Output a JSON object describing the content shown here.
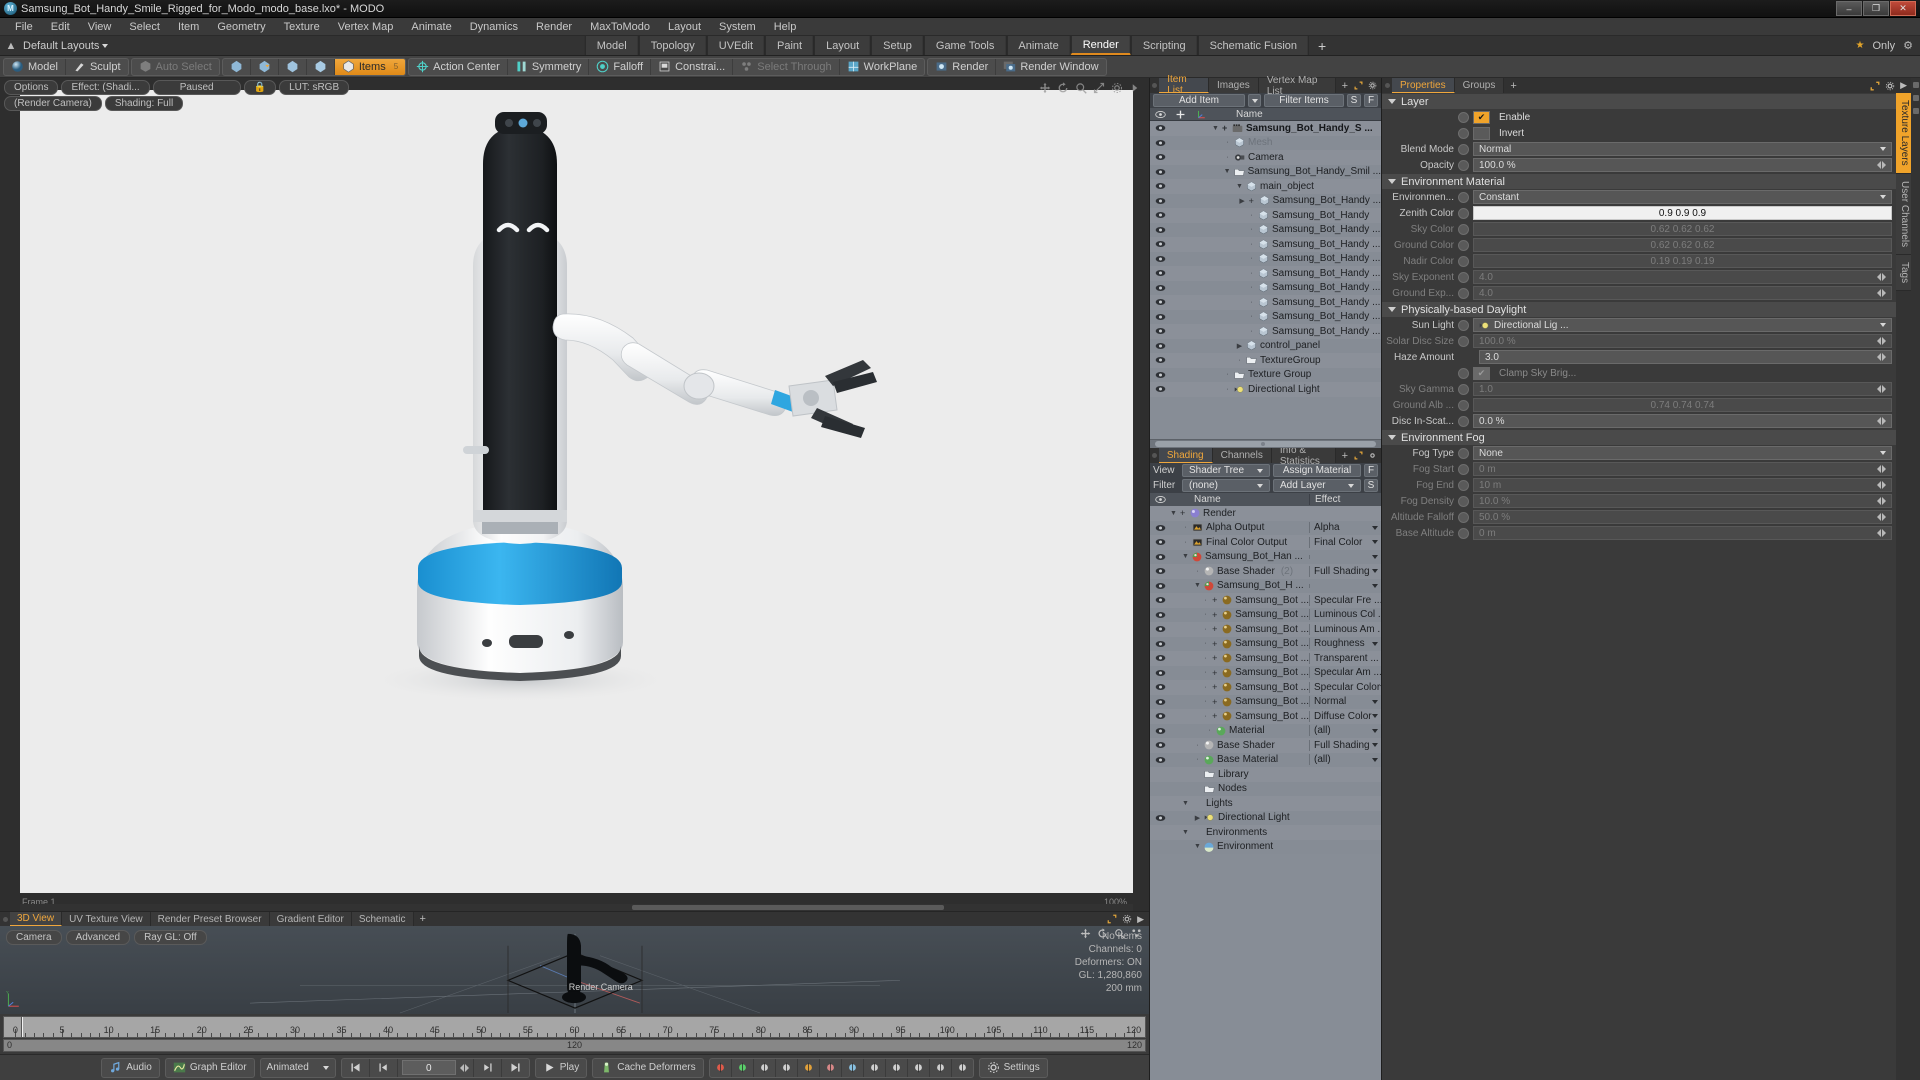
{
  "window": {
    "title": "Samsung_Bot_Handy_Smile_Rigged_for_Modo_modo_base.lxo* - MODO",
    "app_icon": "modo-logo-icon",
    "minimize": "–",
    "maximize": "❐",
    "close": "✕"
  },
  "menubar": {
    "items": [
      "File",
      "Edit",
      "View",
      "Select",
      "Item",
      "Geometry",
      "Texture",
      "Vertex Map",
      "Animate",
      "Dynamics",
      "Render",
      "MaxToModo",
      "Layout",
      "System",
      "Help"
    ]
  },
  "layoutbar": {
    "dropdown_label": "Default Layouts",
    "tabs": [
      {
        "label": "Model",
        "active": false
      },
      {
        "label": "Topology",
        "active": false
      },
      {
        "label": "UVEdit",
        "active": false
      },
      {
        "label": "Paint",
        "active": false
      },
      {
        "label": "Layout",
        "active": false
      },
      {
        "label": "Setup",
        "active": false
      },
      {
        "label": "Game Tools",
        "active": false
      },
      {
        "label": "Animate",
        "active": false
      },
      {
        "label": "Render",
        "active": true
      },
      {
        "label": "Scripting",
        "active": false
      },
      {
        "label": "Schematic Fusion",
        "active": false
      }
    ],
    "add_tab": "+",
    "only_label": "Only",
    "star_icon": "star-icon",
    "gear_icon": "gear-icon"
  },
  "toolbar": {
    "group1": [
      {
        "label": "Model",
        "icon": "sphere-icon",
        "state": "normal"
      },
      {
        "label": "Sculpt",
        "icon": "brush-icon",
        "state": "normal"
      }
    ],
    "group2": [
      {
        "label": "Auto Select",
        "icon": "cube-gray-icon",
        "state": "dim"
      }
    ],
    "group3": [
      {
        "label": "",
        "icon": "vertex-icon",
        "state": "normal"
      },
      {
        "label": "",
        "icon": "edge-icon",
        "state": "normal"
      },
      {
        "label": "",
        "icon": "polygon-icon",
        "state": "normal"
      },
      {
        "label": "",
        "icon": "material-icon",
        "state": "normal"
      },
      {
        "label": "Items",
        "icon": "cube-icon",
        "state": "active",
        "badge": "5"
      }
    ],
    "group4": [
      {
        "label": "Action Center",
        "icon": "target-icon",
        "state": "normal"
      },
      {
        "label": "Symmetry",
        "icon": "symmetry-icon",
        "state": "normal"
      },
      {
        "label": "Falloff",
        "icon": "falloff-icon",
        "state": "normal"
      },
      {
        "label": "Constrai...",
        "icon": "constraint-icon",
        "state": "normal"
      },
      {
        "label": "Select Through",
        "icon": "select-through-icon",
        "state": "dim"
      },
      {
        "label": "WorkPlane",
        "icon": "workplane-icon",
        "state": "normal"
      }
    ],
    "group5": [
      {
        "label": "Render",
        "icon": "render-icon",
        "state": "normal"
      },
      {
        "label": "Render Window",
        "icon": "render-window-icon",
        "state": "normal"
      }
    ]
  },
  "viewport": {
    "pills_row1": [
      "Options",
      "Effect: (Shadi...",
      "Paused"
    ],
    "lock_icon": "lock-icon",
    "lut_label": "LUT: sRGB",
    "pills_row2": [
      "(Render Camera)",
      "Shading: Full"
    ],
    "icons": [
      "move-icon",
      "rotate-icon",
      "zoom-icon",
      "fit-icon",
      "gear-icon",
      "expand-icon"
    ],
    "corner_left": "Frame 1",
    "corner_right": "100%",
    "subject": "Samsung Bot Handy service robot render"
  },
  "item_list": {
    "tabs": [
      {
        "label": "Item List",
        "active": true
      },
      {
        "label": "Images",
        "active": false
      },
      {
        "label": "Vertex Map List",
        "active": false
      }
    ],
    "add_tab": "+",
    "expand_icon": "expand-icon",
    "gear_icon": "gear-icon",
    "add_item_label": "Add Item",
    "filter_items_label": "Filter Items",
    "s_button": "S",
    "f_button": "F",
    "columns": {
      "eye": "visibility-icon",
      "lock": "lock-column-icon",
      "axis": "transform-icon",
      "name": "Name"
    },
    "rows": [
      {
        "label": "Samsung_Bot_Handy_S ...",
        "icon": "scene-icon",
        "indent": 1,
        "eye": true,
        "disclosure": "down",
        "plus": true,
        "bold": true
      },
      {
        "label": "Mesh",
        "icon": "cube-icon",
        "indent": 2,
        "eye": true,
        "disclosure": "dot",
        "dim": true
      },
      {
        "label": "Camera",
        "icon": "camera-icon",
        "indent": 2,
        "eye": true,
        "disclosure": "dot"
      },
      {
        "label": "Samsung_Bot_Handy_Smil ...",
        "icon": "folder-icon",
        "indent": 2,
        "eye": true,
        "disclosure": "down"
      },
      {
        "label": "main_object",
        "icon": "cube-icon",
        "indent": 3,
        "eye": true,
        "disclosure": "down"
      },
      {
        "label": "Samsung_Bot_Handy ...",
        "icon": "cube-icon",
        "indent": 4,
        "eye": true,
        "disclosure": "right",
        "plus": true
      },
      {
        "label": "Samsung_Bot_Handy",
        "icon": "cube-icon",
        "indent": 4,
        "eye": true,
        "disclosure": "dot"
      },
      {
        "label": "Samsung_Bot_Handy ...",
        "icon": "cube-icon",
        "indent": 4,
        "eye": true,
        "disclosure": "dot"
      },
      {
        "label": "Samsung_Bot_Handy ...",
        "icon": "cube-icon",
        "indent": 4,
        "eye": true,
        "disclosure": "dot"
      },
      {
        "label": "Samsung_Bot_Handy ...",
        "icon": "cube-icon",
        "indent": 4,
        "eye": true,
        "disclosure": "dot"
      },
      {
        "label": "Samsung_Bot_Handy ...",
        "icon": "cube-icon",
        "indent": 4,
        "eye": true,
        "disclosure": "dot"
      },
      {
        "label": "Samsung_Bot_Handy ...",
        "icon": "cube-icon",
        "indent": 4,
        "eye": true,
        "disclosure": "dot"
      },
      {
        "label": "Samsung_Bot_Handy ...",
        "icon": "cube-icon",
        "indent": 4,
        "eye": true,
        "disclosure": "dot"
      },
      {
        "label": "Samsung_Bot_Handy ...",
        "icon": "cube-icon",
        "indent": 4,
        "eye": true,
        "disclosure": "dot"
      },
      {
        "label": "Samsung_Bot_Handy ...",
        "icon": "cube-icon",
        "indent": 4,
        "eye": true,
        "disclosure": "dot"
      },
      {
        "label": "control_panel",
        "icon": "cube-icon",
        "indent": 3,
        "eye": true,
        "disclosure": "right"
      },
      {
        "label": "TextureGroup",
        "icon": "folder-icon",
        "indent": 3,
        "eye": true,
        "disclosure": "dot"
      },
      {
        "label": "Texture Group",
        "icon": "folder-icon",
        "indent": 2,
        "eye": true,
        "disclosure": "dot"
      },
      {
        "label": "Directional Light",
        "icon": "light-icon",
        "indent": 2,
        "eye": true,
        "disclosure": "dot"
      }
    ]
  },
  "shading": {
    "tabs": [
      {
        "label": "Shading",
        "active": true
      },
      {
        "label": "Channels",
        "active": false
      },
      {
        "label": "Info & Statistics",
        "active": false
      }
    ],
    "add_tab": "+",
    "view_label": "View",
    "view_value": "Shader Tree",
    "assign_material": "Assign Material",
    "filter_label": "Filter",
    "filter_value": "(none)",
    "add_layer": "Add Layer",
    "f_button": "F",
    "s_button": "S",
    "columns": {
      "eye": "visibility-icon",
      "name": "Name",
      "effect": "Effect"
    },
    "rows": [
      {
        "label": "Render",
        "effect": "",
        "icon": "render-sphere-icon",
        "indent": 1,
        "eye": false,
        "disclosure": "down",
        "plus": true
      },
      {
        "label": "Alpha Output",
        "effect": "Alpha",
        "icon": "image-icon",
        "indent": 2,
        "eye": true,
        "disclosure": "dot",
        "caret": true
      },
      {
        "label": "Final Color Output",
        "effect": "Final Color",
        "icon": "image-icon",
        "indent": 2,
        "eye": true,
        "disclosure": "dot",
        "caret": true
      },
      {
        "label": "Samsung_Bot_Han ...",
        "effect": "",
        "icon": "material-red-icon",
        "indent": 2,
        "eye": true,
        "disclosure": "down",
        "caret": true
      },
      {
        "label": "Base Shader",
        "effect": "Full Shading",
        "sub": "(2)",
        "icon": "shader-icon",
        "indent": 3,
        "eye": true,
        "disclosure": "dot",
        "caret": true
      },
      {
        "label": "Samsung_Bot_H ...",
        "effect": "",
        "icon": "material-red-icon",
        "indent": 3,
        "eye": true,
        "disclosure": "down",
        "caret": true
      },
      {
        "label": "Samsung_Bot ...",
        "effect": "Specular Fre ...",
        "icon": "texture-icon",
        "indent": 4,
        "eye": true,
        "disclosure": "dot",
        "plus": true
      },
      {
        "label": "Samsung_Bot ...",
        "effect": "Luminous Col ...",
        "icon": "texture-icon",
        "indent": 4,
        "eye": true,
        "disclosure": "dot",
        "plus": true
      },
      {
        "label": "Samsung_Bot ...",
        "effect": "Luminous Am ...",
        "icon": "texture-icon",
        "indent": 4,
        "eye": true,
        "disclosure": "dot",
        "plus": true
      },
      {
        "label": "Samsung_Bot ...",
        "effect": "Roughness",
        "icon": "texture-icon",
        "indent": 4,
        "eye": true,
        "disclosure": "dot",
        "plus": true,
        "caret": true
      },
      {
        "label": "Samsung_Bot ...",
        "effect": "Transparent ...",
        "icon": "texture-icon",
        "indent": 4,
        "eye": true,
        "disclosure": "dot",
        "plus": true
      },
      {
        "label": "Samsung_Bot ...",
        "effect": "Specular Am ...",
        "icon": "texture-icon",
        "indent": 4,
        "eye": true,
        "disclosure": "dot",
        "plus": true
      },
      {
        "label": "Samsung_Bot ...",
        "effect": "Specular Color",
        "icon": "texture-icon",
        "indent": 4,
        "eye": true,
        "disclosure": "dot",
        "plus": true,
        "caret": true
      },
      {
        "label": "Samsung_Bot ...",
        "effect": "Normal",
        "icon": "texture-icon",
        "indent": 4,
        "eye": true,
        "disclosure": "dot",
        "plus": true,
        "caret": true
      },
      {
        "label": "Samsung_Bot ...",
        "effect": "Diffuse Color",
        "icon": "texture-icon",
        "indent": 4,
        "eye": true,
        "disclosure": "dot",
        "plus": true,
        "caret": true
      },
      {
        "label": "Material",
        "effect": "(all)",
        "icon": "material-green-icon",
        "indent": 4,
        "eye": true,
        "disclosure": "dot",
        "caret": true
      },
      {
        "label": "Base Shader",
        "effect": "Full Shading",
        "icon": "shader-icon",
        "indent": 3,
        "eye": true,
        "disclosure": "dot",
        "caret": true
      },
      {
        "label": "Base Material",
        "effect": "(all)",
        "icon": "material-green-icon",
        "indent": 3,
        "eye": true,
        "disclosure": "dot",
        "caret": true
      },
      {
        "label": "Library",
        "effect": "",
        "icon": "folder-icon",
        "indent": 3,
        "eye": false
      },
      {
        "label": "Nodes",
        "effect": "",
        "icon": "folder-icon",
        "indent": 3,
        "eye": false
      },
      {
        "label": "Lights",
        "effect": "",
        "icon": "",
        "indent": 2,
        "eye": false,
        "disclosure": "down"
      },
      {
        "label": "Directional Light",
        "effect": "",
        "icon": "light-icon",
        "indent": 3,
        "eye": true,
        "disclosure": "right"
      },
      {
        "label": "Environments",
        "effect": "",
        "icon": "",
        "indent": 2,
        "eye": false,
        "disclosure": "down"
      },
      {
        "label": "Environment",
        "effect": "",
        "icon": "env-icon",
        "indent": 3,
        "eye": false,
        "disclosure": "down"
      }
    ]
  },
  "properties": {
    "tabs": [
      {
        "label": "Properties",
        "active": true
      },
      {
        "label": "Groups",
        "active": false
      }
    ],
    "add_tab": "+",
    "expand_icon": "expand-icon",
    "gear_icon": "gear-icon",
    "sections": [
      {
        "title": "Layer",
        "fields": [
          {
            "label": "",
            "type": "checkbox",
            "value": "Enable",
            "checked": true,
            "knob": true
          },
          {
            "label": "",
            "type": "checkbox",
            "value": "Invert",
            "checked": false,
            "knob": true
          },
          {
            "label": "Blend Mode",
            "type": "dropdown",
            "value": "Normal",
            "knob": true
          },
          {
            "label": "Opacity",
            "type": "spinner",
            "value": "100.0 %",
            "knob": true
          }
        ]
      },
      {
        "title": "Environment Material",
        "fields": [
          {
            "label": "Environmen...",
            "type": "dropdown",
            "value": "Constant",
            "knob": true
          },
          {
            "label": "Zenith Color",
            "type": "color",
            "value": "0.9  0.9  0.9",
            "knob": true,
            "light": true
          },
          {
            "label": "Sky Color",
            "type": "color",
            "value": "0.62 0.62 0.62",
            "knob": true,
            "dim": true
          },
          {
            "label": "Ground Color",
            "type": "color",
            "value": "0.62 0.62 0.62",
            "knob": true,
            "dim": true
          },
          {
            "label": "Nadir Color",
            "type": "color",
            "value": "0.19 0.19 0.19",
            "knob": true,
            "dim": true
          },
          {
            "label": "Sky Exponent",
            "type": "spinner",
            "value": "4.0",
            "knob": true,
            "dim": true
          },
          {
            "label": "Ground Exp...",
            "type": "spinner",
            "value": "4.0",
            "knob": true,
            "dim": true
          }
        ]
      },
      {
        "title": "Physically-based Daylight",
        "fields": [
          {
            "label": "Sun Light",
            "type": "dropdown",
            "value": "Directional Lig ...",
            "icon": "light-icon"
          },
          {
            "label": "Solar Disc Size",
            "type": "spinner",
            "value": "100.0 %",
            "knob": true,
            "dim": true
          },
          {
            "label": "Haze Amount",
            "type": "spinner",
            "value": "3.0",
            "knob": false
          },
          {
            "label": "",
            "type": "checkbox",
            "value": "Clamp Sky Brig...",
            "checked": true,
            "knob": true,
            "dim": true
          },
          {
            "label": "Sky Gamma",
            "type": "spinner",
            "value": "1.0",
            "knob": true,
            "dim": true
          },
          {
            "label": "Ground Alb ...",
            "type": "color",
            "value": "0.74 0.74 0.74",
            "knob": true,
            "dim": true
          },
          {
            "label": "Disc In-Scat...",
            "type": "spinner",
            "value": "0.0 %",
            "knob": true
          }
        ]
      },
      {
        "title": "Environment Fog",
        "fields": [
          {
            "label": "Fog Type",
            "type": "dropdown",
            "value": "None",
            "knob": true
          },
          {
            "label": "Fog Start",
            "type": "spinner",
            "value": "0 m",
            "knob": true,
            "dim": true
          },
          {
            "label": "Fog End",
            "type": "spinner",
            "value": "10 m",
            "knob": true,
            "dim": true
          },
          {
            "label": "Fog Density",
            "type": "spinner",
            "value": "10.0 %",
            "knob": true,
            "dim": true
          },
          {
            "label": "Altitude Falloff",
            "type": "spinner",
            "value": "50.0 %",
            "knob": true,
            "dim": true
          },
          {
            "label": "Base Altitude",
            "type": "spinner",
            "value": "0 m",
            "knob": true,
            "dim": true
          }
        ]
      }
    ],
    "side_tabs": [
      {
        "label": "Texture Layers",
        "active": true
      },
      {
        "label": "User Channels",
        "active": false
      },
      {
        "label": "Tags",
        "active": false
      }
    ]
  },
  "view3d": {
    "tabs": [
      {
        "label": "3D View",
        "active": true
      },
      {
        "label": "UV Texture View",
        "active": false
      },
      {
        "label": "Render Preset Browser",
        "active": false
      },
      {
        "label": "Gradient Editor",
        "active": false
      },
      {
        "label": "Schematic",
        "active": false
      }
    ],
    "add_tab": "+",
    "buttons": [
      "Camera",
      "Advanced",
      "Ray GL: Off"
    ],
    "icons": [
      "move-icon",
      "rotate-icon",
      "zoom-icon",
      "fit-icon"
    ],
    "info": [
      "No Items",
      "Channels: 0",
      "Deformers: ON",
      "GL: 1,280,860",
      "200 mm"
    ],
    "camera_label": "Render Camera"
  },
  "timeline": {
    "ticks": [
      0,
      5,
      10,
      15,
      20,
      25,
      30,
      35,
      40,
      45,
      50,
      55,
      60,
      65,
      70,
      75,
      80,
      85,
      90,
      95,
      100,
      105,
      110,
      115,
      120
    ],
    "range_start": "0",
    "range_mid": "120",
    "range_end": "120",
    "playhead_frame": 0
  },
  "playbar": {
    "audio": "Audio",
    "graph_editor": "Graph Editor",
    "mode": "Animated",
    "frame_value": "0",
    "play": "Play",
    "cache_deformers": "Cache Deformers",
    "settings": "Settings",
    "transport": [
      "go-to-start-icon",
      "step-back-icon",
      "step-forward-icon",
      "go-to-end-icon"
    ],
    "tool_icons": [
      "key-create-icon",
      "key-delete-icon",
      "range-start-icon",
      "range-prev-icon",
      "curve-icon",
      "ellipse-icon",
      "graph-icon",
      "next-key-icon",
      "last-key-icon",
      "ik-icon",
      "rotate-key-icon",
      "scale-key-icon"
    ]
  }
}
